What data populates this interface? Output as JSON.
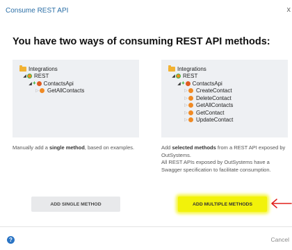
{
  "dialog": {
    "title": "Consume REST API",
    "close_label": "x",
    "heading": "You have two ways of consuming REST API methods:"
  },
  "left_option": {
    "tree": {
      "root": "Integrations",
      "rest": "REST",
      "api": "ContactsApi",
      "methods": [
        "GetAllContacts"
      ]
    },
    "description": {
      "part1": "Manually add a ",
      "bold1": "single method",
      "part2": ", based on examples."
    },
    "button_label": "ADD SINGLE METHOD"
  },
  "right_option": {
    "tree": {
      "root": "Integrations",
      "rest": "REST",
      "api": "ContactsApi",
      "methods": [
        "CreateContact",
        "DeleteContact",
        "GetAllContacts",
        "GetContact",
        "UpdateContact"
      ]
    },
    "description": {
      "part1": "Add ",
      "bold1": "selected methods",
      "part2": " from a REST API exposed by OutSystems.",
      "line2": "All REST APIs exposed by OutSystems have a Swagger specification to facilitate consumption."
    },
    "button_label": "ADD MULTIPLE METHODS"
  },
  "footer": {
    "help_label": "?",
    "cancel_label": "Cancel"
  },
  "colors": {
    "title_blue": "#2a6ea6",
    "highlight_yellow": "#f2f20a",
    "annotation_red": "#e0201b"
  },
  "icons": {
    "folder": "folder-icon",
    "rest": "rest-icon",
    "api": "api-icon",
    "method": "method-icon",
    "help": "help-icon",
    "arrow": "red-arrow-icon"
  }
}
